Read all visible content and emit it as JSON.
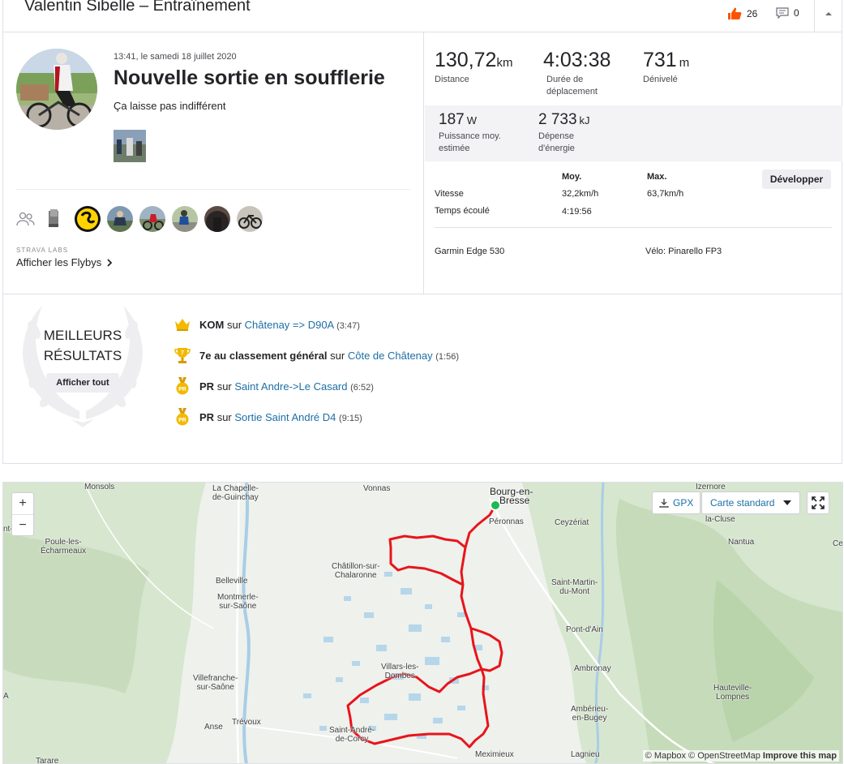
{
  "header": {
    "title": "Valentin Sibelle – Entraînement",
    "kudos_count": "26",
    "comment_count": "0"
  },
  "activity": {
    "date": "13:41, le samedi 18 juillet 2020",
    "name": "Nouvelle sortie en soufflerie",
    "description": "Ça laisse pas indifférent",
    "labs_label": "STRAVA LABS",
    "flyby_label": "Afficher les Flybys"
  },
  "stats": {
    "distance": {
      "value": "130,72",
      "unit": "km",
      "label": "Distance"
    },
    "moving_time": {
      "value": "4:03:38",
      "label1": "Durée de",
      "label2": "déplacement"
    },
    "elevation": {
      "value": "731",
      "unit": "m",
      "label": "Dénivelé"
    },
    "power": {
      "value": "187",
      "unit": "W",
      "label1": "Puissance moy.",
      "label2": "estimée"
    },
    "energy": {
      "value": "2 733",
      "unit": "kJ",
      "label1": "Dépense",
      "label2": "d'énergie"
    }
  },
  "more_stats": {
    "col_avg": "Moy.",
    "col_max": "Max.",
    "expand_label": "Développer",
    "rows": [
      {
        "label": "Vitesse",
        "avg": "32,2km/h",
        "max": "63,7km/h"
      },
      {
        "label": "Temps écoulé",
        "avg": "4:19:56",
        "max": ""
      }
    ],
    "device": "Garmin Edge 530",
    "bike": "Vélo: Pinarello FP3"
  },
  "achievements": {
    "title_line1": "MEILLEURS",
    "title_line2": "RÉSULTATS",
    "see_all": "Afficher tout",
    "items": [
      {
        "type": "KOM",
        "sep": "sur",
        "segment": "Châtenay => D90A",
        "time": "(3:47)",
        "icon": "crown-icon"
      },
      {
        "type": "7e au classement général",
        "sep": "sur",
        "segment": "Côte de Châtenay",
        "time": "(1:56)",
        "icon": "trophy-icon"
      },
      {
        "type": "PR",
        "sep": "sur",
        "segment": "Saint Andre->Le Casard",
        "time": "(6:52)",
        "icon": "pr-medal-icon"
      },
      {
        "type": "PR",
        "sep": "sur",
        "segment": "Sortie Saint André D4",
        "time": "(9:15)",
        "icon": "pr-medal-icon"
      }
    ]
  },
  "map": {
    "zoom_in": "+",
    "zoom_out": "−",
    "gpx_label": "GPX",
    "style_label": "Carte standard",
    "attribution_mapbox": "© Mapbox",
    "attribution_osm": "© OpenStreetMap",
    "attribution_improve": "Improve this map",
    "places": {
      "monsols": "Monsols",
      "chapelle_line1": "La Chapelle-",
      "chapelle_line2": "de-Guinchay",
      "vonnas": "Vonnas",
      "bourg_line1": "Bourg-en-",
      "bourg_line2": "Bresse",
      "izernore": "Izernore",
      "peronnas": "Péronnas",
      "ceyzeriat": "Ceyzériat",
      "cluse": "la-Cluse",
      "nantua": "Nantua",
      "ce_partial": "Ce",
      "nt_partial": "nt-",
      "poule_line1": "Poule-les-",
      "poule_line2": "Écharmeaux",
      "chatillon_line1": "Châtillon-sur-",
      "chatillon_line2": "Chalaronne",
      "belleville": "Belleville",
      "st_martin_line1": "Saint-Martin-",
      "st_martin_line2": "du-Mont",
      "montmerle_line1": "Montmerle-",
      "montmerle_line2": "sur-Saône",
      "pont_ain": "Pont-d'Ain",
      "villars_line1": "Villars-les-",
      "villars_line2": "Dombes",
      "ambronay": "Ambronay",
      "villefranche_line1": "Villefranche-",
      "villefranche_line2": "sur-Saône",
      "hauteville_line1": "Hauteville-",
      "hauteville_line2": "Lompnes",
      "amberieu_line1": "Ambérieu-",
      "amberieu_line2": "en-Bugey",
      "anse": "Anse",
      "trevoux": "Trévoux",
      "st_andre_line1": "Saint-André-",
      "st_andre_line2": "de-Corcy",
      "meximieux": "Meximieux",
      "lagnieu": "Lagnieu",
      "tarare": "Tarare",
      "a_partial": "A"
    }
  },
  "colors": {
    "brand": "#fc5200",
    "link": "#1d6fa5",
    "route": "#e8141b",
    "start_marker": "#1db954",
    "gold": "#f2b900"
  }
}
